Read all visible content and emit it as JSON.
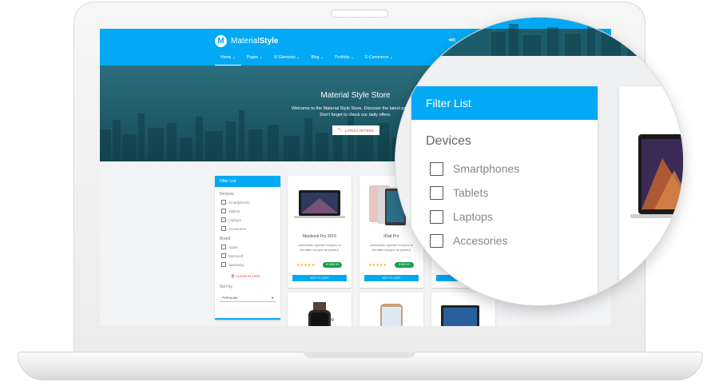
{
  "brand": {
    "logo_letter": "M",
    "name_regular": "Material",
    "name_bold": "Style"
  },
  "nav": [
    {
      "label": "Home ⌄",
      "active": true
    },
    {
      "label": "Pages ⌄",
      "active": false
    },
    {
      "label": "UI Elements ⌄",
      "active": false
    },
    {
      "label": "Blog ⌄",
      "active": false
    },
    {
      "label": "Portfolio ⌄",
      "active": false
    },
    {
      "label": "E-Commerce ⌄",
      "active": false
    }
  ],
  "hero": {
    "title": "Material Style Store",
    "line1": "Welcome to the Material Style Store. Discover the latest products.",
    "line2": "Don't forget to check our daily offers.",
    "button": "LATEST OFFERS"
  },
  "filter": {
    "title": "Filter List",
    "devices_heading": "Devices",
    "devices": [
      "Smartphones",
      "Tablets",
      "Laptops",
      "Accesories"
    ],
    "brand_heading": "Brand",
    "brands": [
      "Apple",
      "Microsoft",
      "Samsung"
    ],
    "clear": "CLEAR FILTERS",
    "sort_heading": "Sort by",
    "sort_value": "POPULAR"
  },
  "products": [
    {
      "name": "Macbook Pro 2015",
      "desc": "Quibusdam aperiam tempora ut blanditiis cumque ab pariatur.",
      "stars": "★★★★★",
      "price": "$ 1999.99",
      "button": "ADD TO CART"
    },
    {
      "name": "iPad Pro",
      "desc": "Quibusdam aperiam tempora ut blanditiis cumque ab pariatur.",
      "stars": "★★★★★",
      "price": "$ 999.99",
      "button": "ADD TO CART"
    },
    {
      "name": "",
      "desc": "",
      "stars": "",
      "price": "",
      "button": "ADD TO CART"
    }
  ],
  "magnified": {
    "title": "Filter List",
    "devices_heading": "Devices",
    "devices": [
      "Smartphones",
      "Tablets",
      "Laptops",
      "Accesories"
    ]
  },
  "colors": {
    "primary": "#03a9f4",
    "price": "#1b9e4b",
    "accent": "#e53935",
    "stars": "#ffb300"
  }
}
